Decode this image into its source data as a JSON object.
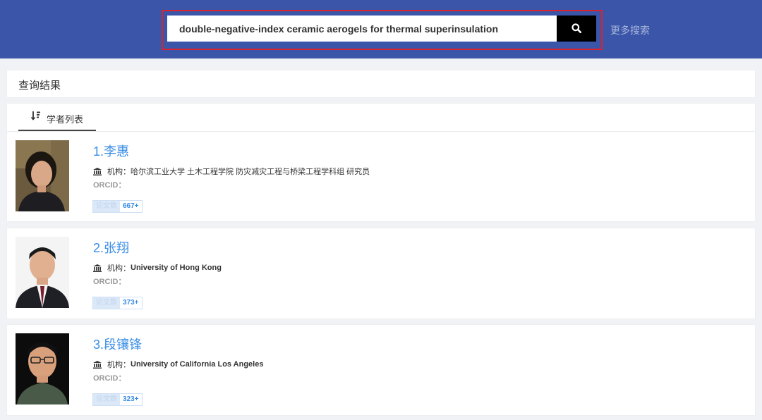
{
  "search": {
    "query": "double-negative-index ceramic aerogels for thermal superinsulation",
    "more_search": "更多搜索"
  },
  "results": {
    "title": "查询结果",
    "tab_label": "学者列表"
  },
  "scholars": [
    {
      "name": "1.李惠",
      "institution_label": "机构：",
      "institution": "哈尔滨工业大学 土木工程学院 防灾减灾工程与桥梁工程学科组 研究员",
      "orcid_label": "ORCID：",
      "papers_label": "论文数",
      "papers_count": "667+"
    },
    {
      "name": "2.张翔",
      "institution_label": "机构：",
      "institution": "University of Hong Kong",
      "orcid_label": "ORCID：",
      "papers_label": "论文数",
      "papers_count": "373+"
    },
    {
      "name": "3.段镶锋",
      "institution_label": "机构：",
      "institution": "University of California Los Angeles",
      "orcid_label": "ORCID：",
      "papers_label": "论文数",
      "papers_count": "323+"
    }
  ],
  "colors": {
    "topbar": "#3b55a8",
    "highlight_frame": "#d9232e",
    "link": "#3a8ee6"
  }
}
